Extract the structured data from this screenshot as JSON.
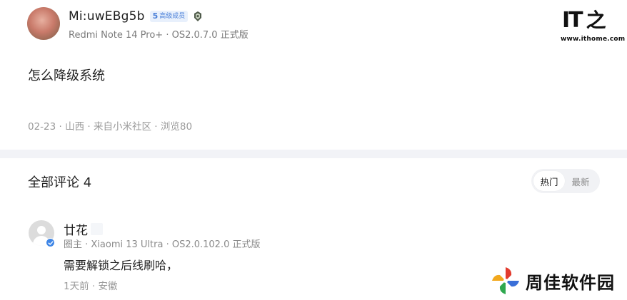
{
  "post": {
    "author_name": "Mi:uwEBg5b",
    "level_number": "5",
    "level_label": "高级成员",
    "device_info": "Redmi Note 14 Pro+ · OS2.0.7.0 正式版",
    "body": "怎么降级系统",
    "meta": "02-23 · 山西 · 来自小米社区 · 浏览80"
  },
  "comments_section": {
    "title": "全部评论 4",
    "sort_options": [
      {
        "label": "热门",
        "active": true
      },
      {
        "label": "最新",
        "active": false
      }
    ]
  },
  "comment": {
    "author_name": "廿花",
    "role_device": "圈主 · Xiaomi 13 Ultra · OS2.0.102.0 正式版",
    "text": "需要解锁之后线刷哈，",
    "meta": "1天前 · 安徽"
  },
  "watermarks": {
    "ithome_mark": "IT",
    "ithome_glyph": "之",
    "ithome_url": "www.ithome.com",
    "zhoujia_name": "周佳软件园"
  },
  "colors": {
    "accent_blue": "#3f86e6",
    "badge_bg": "#e8f0fc",
    "divider_band": "#f2f3f7"
  }
}
